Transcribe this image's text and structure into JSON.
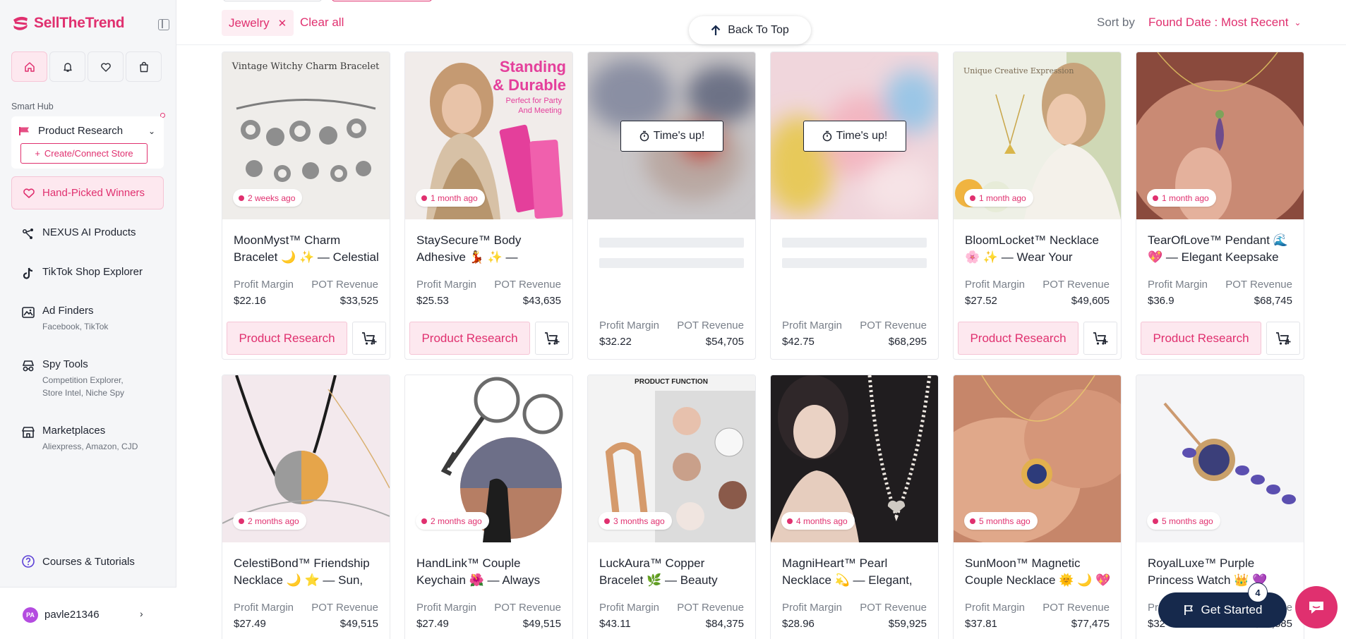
{
  "brand": {
    "name": "SellTheTrend",
    "accent": "#e0306f",
    "nav_dark": "#16294c"
  },
  "sidebar": {
    "smart_hub_label": "Smart Hub",
    "research_select": "Product Research",
    "create_store": "Create/Connect Store",
    "active_item": "Hand-Picked Winners",
    "items": [
      {
        "title": "NEXUS AI Products",
        "sub": "",
        "icon": "nexus-icon"
      },
      {
        "title": "TikTok Shop Explorer",
        "sub": "",
        "icon": "tiktok-icon"
      },
      {
        "title": "Ad Finders",
        "sub": "Facebook, TikTok",
        "icon": "ad-icon"
      },
      {
        "title": "Spy Tools",
        "sub": "Competition Explorer,\nStore Intel, Niche Spy",
        "icon": "spy-icon"
      },
      {
        "title": "Marketplaces",
        "sub": "Aliexpress, Amazon, CJD",
        "icon": "store-icon"
      }
    ],
    "courses": "Courses & Tutorials",
    "user": {
      "initials": "PA",
      "name": "pavle21346"
    }
  },
  "filters": {
    "chip": "Jewelry",
    "clear_all": "Clear all"
  },
  "back_to_top": "Back To Top",
  "sort": {
    "label": "Sort by",
    "value": "Found Date : Most Recent"
  },
  "labels": {
    "profit": "Profit Margin",
    "revenue": "POT Revenue",
    "research": "Product Research",
    "times_up": "Time's up!"
  },
  "products": [
    {
      "title": "MoonMyst™ Charm Bracelet 🌙 ✨ — Celestial",
      "age": "2 weeks ago",
      "profit": "$22.16",
      "revenue": "$33,525"
    },
    {
      "title": "StaySecure™ Body Adhesive 💃 ✨ —",
      "age": "1 month ago",
      "profit": "$25.53",
      "revenue": "$43,635"
    },
    {
      "title": "",
      "age": "",
      "profit": "$32.22",
      "revenue": "$54,705"
    },
    {
      "title": "",
      "age": "",
      "profit": "$42.75",
      "revenue": "$68,295"
    },
    {
      "title": "BloomLocket™ Necklace 🌸 ✨ — Wear Your",
      "age": "1 month ago",
      "profit": "$27.52",
      "revenue": "$49,605"
    },
    {
      "title": "TearOfLove™ Pendant 🌊 💖 — Elegant Keepsake",
      "age": "1 month ago",
      "profit": "$36.9",
      "revenue": "$68,745"
    },
    {
      "title": "CelestiBond™ Friendship Necklace 🌙 ⭐ — Sun,",
      "age": "2 months ago",
      "profit": "$27.49",
      "revenue": "$49,515"
    },
    {
      "title": "HandLink™ Couple Keychain 🌺 — Always",
      "age": "2 months ago",
      "profit": "$27.49",
      "revenue": "$49,515"
    },
    {
      "title": "LuckAura™ Copper Bracelet 🌿 — Beauty",
      "age": "3 months ago",
      "profit": "$43.11",
      "revenue": "$84,375"
    },
    {
      "title": "MagniHeart™ Pearl Necklace 💫 — Elegant,",
      "age": "4 months ago",
      "profit": "$28.96",
      "revenue": "$59,925"
    },
    {
      "title": "SunMoon™ Magnetic Couple Necklace 🌞 🌙 💖",
      "age": "5 months ago",
      "profit": "$37.81",
      "revenue": "$77,475"
    },
    {
      "title": "RoyalLuxe™ Purple Princess Watch 👑 💜",
      "age": "5 months ago",
      "profit": "$32",
      "revenue": "$61,585"
    }
  ],
  "image_text": {
    "p1": "Vintage Witchy Charm Bracelet",
    "p2a": "Standing",
    "p2b": "& Durable",
    "p2c": "Perfect for Party",
    "p2d": "And Meeting",
    "p5": "Unique Creative Expression",
    "p9": "PRODUCT FUNCTION"
  },
  "get_started": {
    "label": "Get Started",
    "count": "4"
  }
}
